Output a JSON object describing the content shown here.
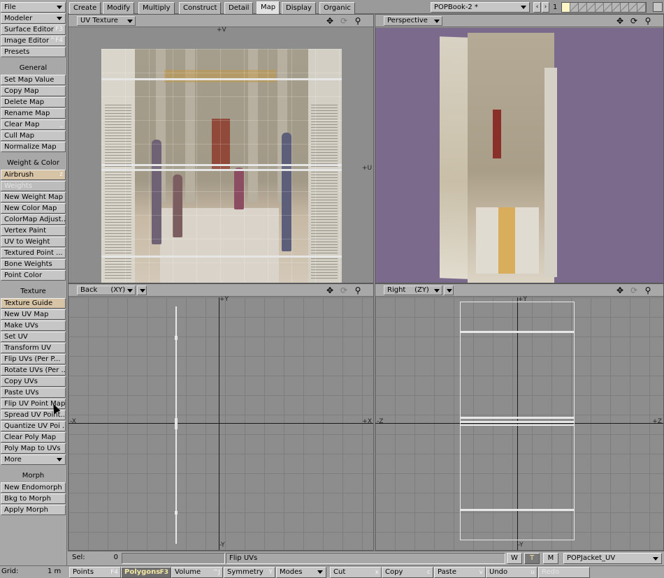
{
  "sidebar": {
    "file": "File",
    "modeler": "Modeler",
    "surface_editor": {
      "label": "Surface Editor",
      "key": "F3"
    },
    "image_editor": {
      "label": "Image Editor",
      "key": "^F4"
    },
    "presets": "Presets",
    "general_head": "General",
    "general": [
      "Set Map Value",
      "Copy Map",
      "Delete Map",
      "Rename Map",
      "Clear Map",
      "Cull Map",
      "Normalize Map"
    ],
    "weight_head": "Weight & Color",
    "airbrush": {
      "label": "Airbrush",
      "key": "z"
    },
    "weights": "Weights",
    "weight_items": [
      "New Weight Map",
      "New Color Map",
      "ColorMap Adjust...",
      "Vertex Paint",
      "UV to Weight",
      "Textured Point ...",
      "Bone Weights",
      "Point Color"
    ],
    "texture_head": "Texture",
    "texture_items": [
      "Texture Guide",
      "New UV Map",
      "Make UVs",
      "Set UV",
      "Transform UV",
      "Flip UVs (Per P...",
      "Rotate UVs (Per ...",
      "Copy UVs",
      "Paste UVs",
      "Flip UV Point Map",
      "Spread UV Point...",
      "Quantize UV Poi ...",
      "Clear Poly Map",
      "Poly Map to UVs"
    ],
    "more": "More",
    "morph_head": "Morph",
    "morph_items": [
      "New Endomorph",
      "Bkg to Morph",
      "Apply Morph"
    ]
  },
  "tabs": [
    "Create",
    "Modify",
    "Multiply",
    "Construct",
    "Detail",
    "Map",
    "Display",
    "Organic"
  ],
  "active_tab": "Map",
  "scene": "POPBook-2 *",
  "layer_number": "1",
  "viewports": {
    "uv": {
      "title": "UV Texture",
      "axis_y": "+V",
      "axis_x": "+U"
    },
    "persp": {
      "title": "Perspective"
    },
    "back": {
      "title": "Back",
      "plane": "(XY)",
      "top": "+Y",
      "bottom": "-Y",
      "left": "-X",
      "right": "+X"
    },
    "right": {
      "title": "Right",
      "plane": "(ZY)",
      "top": "+Y",
      "bottom": "-Y",
      "left": "-Z",
      "right": "+Z"
    }
  },
  "status": {
    "sel_label": "Sel:",
    "sel_value": "0",
    "message": "Flip UVs",
    "w": "W",
    "t": "T",
    "m": "M",
    "vmap": "POPJacket_UV"
  },
  "bottom": {
    "grid_label": "Grid:",
    "grid_value": "1 m",
    "points": {
      "label": "Points",
      "key": "F4"
    },
    "polygons": {
      "label": "Polygons",
      "key": "F3"
    },
    "volume": {
      "label": "Volume",
      "key": "^J"
    },
    "symmetry": {
      "label": "Symmetry",
      "key": "Y"
    },
    "modes": "Modes",
    "cut": {
      "label": "Cut",
      "key": "x"
    },
    "copy": {
      "label": "Copy",
      "key": "c"
    },
    "paste": {
      "label": "Paste",
      "key": "v"
    },
    "undo": {
      "label": "Undo",
      "key": "u"
    },
    "redo": "Redo"
  },
  "colors": {
    "perspective_bg": "#7c6a8c",
    "active_selection": "#f4e7a2"
  }
}
